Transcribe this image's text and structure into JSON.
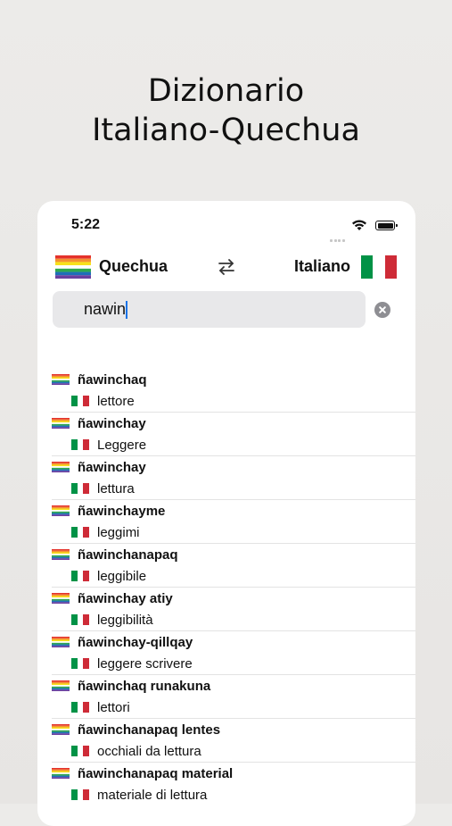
{
  "headline": {
    "line1": "Dizionario",
    "line2": "Italiano-Quechua"
  },
  "status_bar": {
    "time": "5:22"
  },
  "language_bar": {
    "source_language": "Quechua",
    "target_language": "Italiano",
    "source_flag_icon": "wiphala-flag-icon",
    "target_flag_icon": "italy-flag-icon",
    "swap_icon": "swap-arrows-icon"
  },
  "search": {
    "value": "nawin",
    "clear_icon": "clear-circle-icon"
  },
  "results": [
    {
      "term": "ñawinchaq",
      "translation": "lettore"
    },
    {
      "term": "ñawinchay",
      "translation": "Leggere"
    },
    {
      "term": "ñawinchay",
      "translation": "lettura"
    },
    {
      "term": "ñawinchayme",
      "translation": "leggimi"
    },
    {
      "term": "ñawinchanapaq",
      "translation": "leggibile"
    },
    {
      "term": "ñawinchay atiy",
      "translation": "leggibilità"
    },
    {
      "term": "ñawinchay-qillqay",
      "translation": "leggere scrivere"
    },
    {
      "term": "ñawinchaq runakuna",
      "translation": "lettori"
    },
    {
      "term": "ñawinchanapaq lentes",
      "translation": "occhiali da lettura"
    },
    {
      "term": "ñawinchanapaq material",
      "translation": "materiale di lettura"
    }
  ],
  "colors": {
    "italy_green": "#009246",
    "italy_white": "#ffffff",
    "italy_red": "#ce2b37",
    "wiphala_stripes": [
      "#e4322b",
      "#f39131",
      "#f7e11a",
      "#ffffff",
      "#2fa84f",
      "#1f6fb8",
      "#6b3fa0"
    ]
  }
}
